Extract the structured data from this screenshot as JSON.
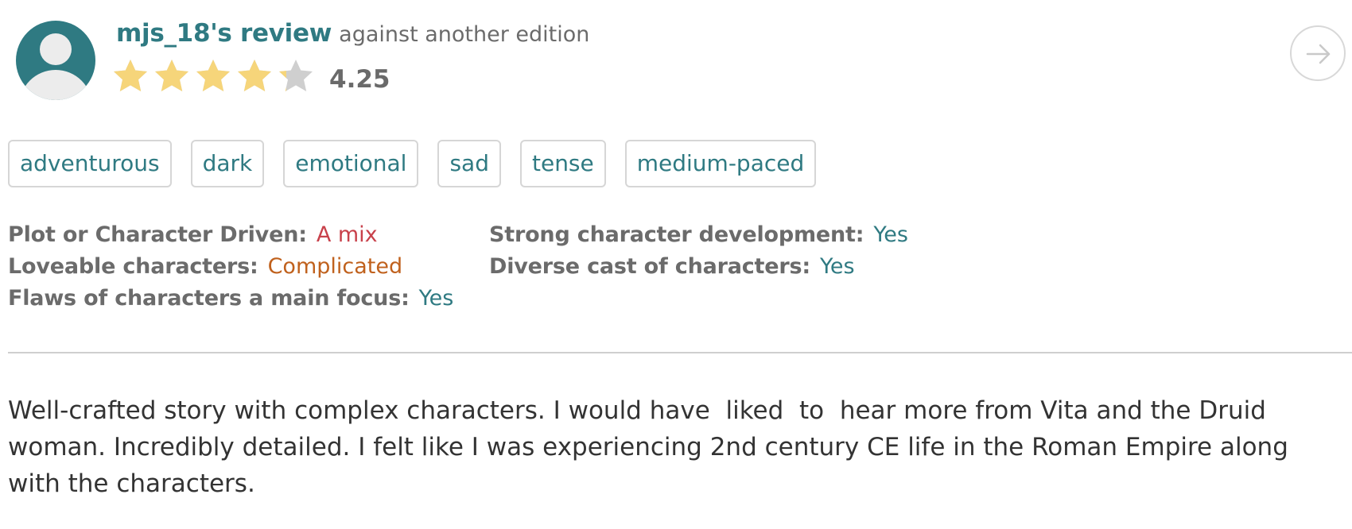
{
  "review": {
    "reviewer": "mjs_18's review",
    "edition_note": "against another edition",
    "rating_text": "4.25",
    "rating_value": 4.25,
    "rating_max": 5,
    "star_colors": {
      "filled": "#f6d57a",
      "empty": "#cfcfcf"
    }
  },
  "icons": {
    "avatar": "user-avatar-icon",
    "next": "arrow-right-icon",
    "star": "star-icon"
  },
  "tags": [
    {
      "label": "adventurous"
    },
    {
      "label": "dark"
    },
    {
      "label": "emotional"
    },
    {
      "label": "sad"
    },
    {
      "label": "tense"
    },
    {
      "label": "medium-paced"
    }
  ],
  "attributes": {
    "left": [
      {
        "label": "Plot or Character Driven:",
        "value": "A mix",
        "color": "#c8414b"
      },
      {
        "label": "Loveable characters:",
        "value": "Complicated",
        "color": "#c0611d"
      },
      {
        "label": "Flaws of characters a main focus:",
        "value": "Yes",
        "color": "#2f7a82"
      }
    ],
    "right": [
      {
        "label": "Strong character development:",
        "value": "Yes",
        "color": "#2f7a82"
      },
      {
        "label": "Diverse cast of characters:",
        "value": "Yes",
        "color": "#2f7a82"
      }
    ]
  },
  "body": "Well-crafted story with complex characters. I would have  liked  to  hear more from Vita and the Druid woman. Incredibly detailed. I felt like I was experiencing 2nd century CE life in the Roman Empire along with the characters."
}
